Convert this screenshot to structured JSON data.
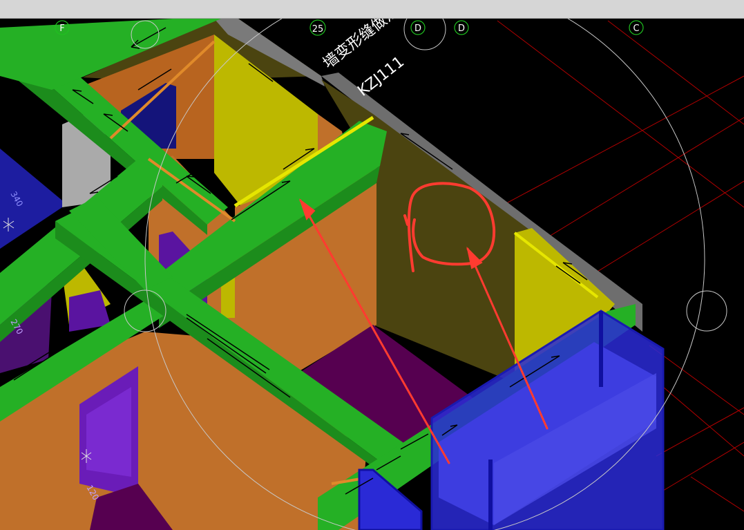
{
  "toolbar": {
    "title": ""
  },
  "grid_axes": [
    {
      "id": "F",
      "label": "F"
    },
    {
      "id": "25",
      "label": "25"
    },
    {
      "id": "D1",
      "label": "D"
    },
    {
      "id": "D2",
      "label": "D"
    },
    {
      "id": "C",
      "label": "C"
    }
  ],
  "model_labels": {
    "wall_note": "墙变形缝做法",
    "column_tag": "KZJ111",
    "dim_a": "340",
    "dim_b": "270",
    "dim_c": "120"
  },
  "annotation": {
    "color": "#ff3b30",
    "description": "red sketch circle with two arrows pointing at wall"
  },
  "colors": {
    "background": "#000000",
    "beam": "#25b025",
    "wall_orange": "#c0702a",
    "wall_olive": "#4b4410",
    "wall_yellow": "#bdb800",
    "floor_purple": "#560050",
    "glass_blue": "#2a2ad6",
    "gridline_red": "#b00000"
  }
}
